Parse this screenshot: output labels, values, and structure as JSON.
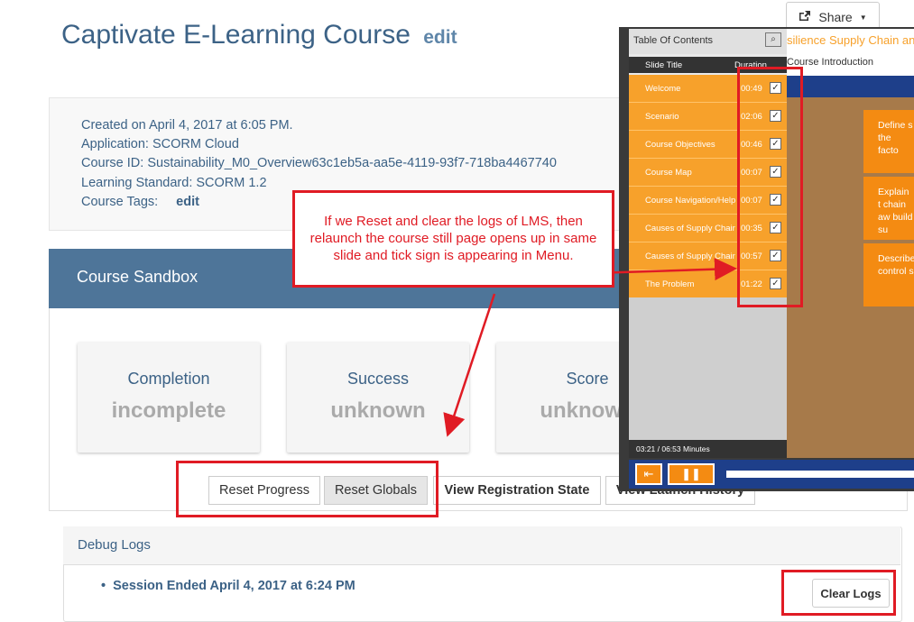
{
  "header": {
    "title": "Captivate E-Learning Course",
    "edit_label": "edit",
    "share_label": "Share"
  },
  "info": {
    "created": "Created on April 4, 2017 at 6:05 PM.",
    "application": "Application: SCORM Cloud",
    "course_id": "Course ID: Sustainability_M0_Overview63c1eb5a-aa5e-4119-93f7-718ba4467740",
    "standard": "Learning Standard: SCORM 1.2",
    "tags_label": "Course Tags:",
    "tags_edit": "edit"
  },
  "sandbox": {
    "title": "Course Sandbox",
    "stats": [
      {
        "label": "Completion",
        "value": "incomplete"
      },
      {
        "label": "Success",
        "value": "unknown"
      },
      {
        "label": "Score",
        "value": "unknown"
      }
    ],
    "buttons": {
      "reset_progress": "Reset Progress",
      "reset_globals": "Reset Globals",
      "view_registration": "View Registration State",
      "view_launch": "View Launch History"
    }
  },
  "debug": {
    "title": "Debug Logs",
    "session": "Session Ended April 4, 2017 at 6:24 PM",
    "clear_label": "Clear Logs"
  },
  "callout": {
    "text": "If we Reset and clear the logs of LMS, then relaunch the course still page opens up in same slide and tick sign is appearing in Menu."
  },
  "player": {
    "toc_title": "Table Of Contents",
    "col_title": "Slide Title",
    "col_duration": "Duration",
    "rows": [
      {
        "title": "Welcome",
        "duration": "00:49"
      },
      {
        "title": "Scenario",
        "duration": "02:06"
      },
      {
        "title": "Course Objectives",
        "duration": "00:46"
      },
      {
        "title": "Course Map",
        "duration": "00:07"
      },
      {
        "title": "Course Navigation/Help",
        "duration": "00:07"
      },
      {
        "title": "Causes of Supply Chain...",
        "duration": "00:35"
      },
      {
        "title": "Causes of Supply Chain...",
        "duration": "00:57"
      },
      {
        "title": "The Problem",
        "duration": "01:22"
      }
    ],
    "time": "03:21 / 06:53 Minutes",
    "slide_title": "silience Supply Chain and",
    "slide_subtitle": "Course Introduction",
    "panels": [
      "Define s the facto",
      "Explain t chain aw build su",
      "Describe control s"
    ]
  },
  "colors": {
    "accent": "#3c6286",
    "header": "#4e7599",
    "annotation": "#e01b24",
    "toc_row": "#f7a12b"
  }
}
